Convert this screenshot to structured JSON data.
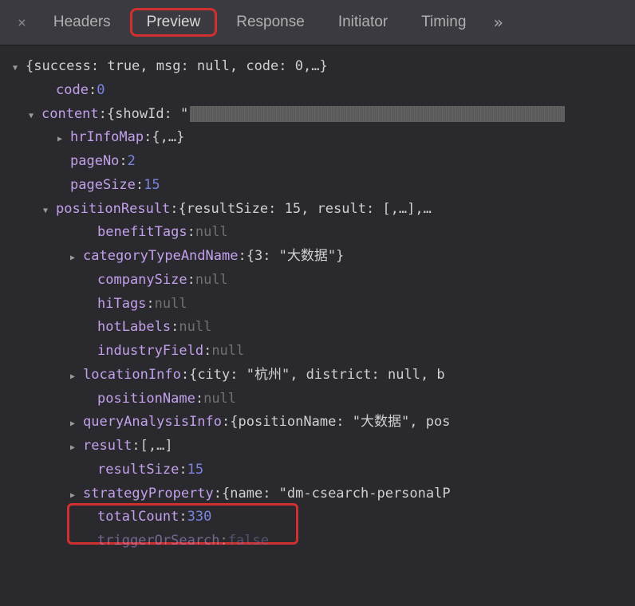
{
  "tabs": {
    "headers": "Headers",
    "preview": "Preview",
    "response": "Response",
    "initiator": "Initiator",
    "timing": "Timing",
    "overflow": "»"
  },
  "json": {
    "root_summary": "{success: true, msg: null, code: 0,…}",
    "code_key": "code",
    "code_val": "0",
    "content_key": "content",
    "content_summary": "{showId: \"",
    "hrInfoMap_key": "hrInfoMap",
    "hrInfoMap_summary": "{,…}",
    "pageNo_key": "pageNo",
    "pageNo_val": "2",
    "pageSize_key": "pageSize",
    "pageSize_val": "15",
    "positionResult_key": "positionResult",
    "positionResult_summary": "{resultSize: 15, result: [,…],…",
    "benefitTags_key": "benefitTags",
    "benefitTags_val": "null",
    "categoryTypeAndName_key": "categoryTypeAndName",
    "categoryTypeAndName_summary": "{3: \"大数据\"}",
    "companySize_key": "companySize",
    "companySize_val": "null",
    "hiTags_key": "hiTags",
    "hiTags_val": "null",
    "hotLabels_key": "hotLabels",
    "hotLabels_val": "null",
    "industryField_key": "industryField",
    "industryField_val": "null",
    "locationInfo_key": "locationInfo",
    "locationInfo_summary": "{city: \"杭州\", district: null, b",
    "positionName_key": "positionName",
    "positionName_val": "null",
    "queryAnalysisInfo_key": "queryAnalysisInfo",
    "queryAnalysisInfo_summary": "{positionName: \"大数据\", pos",
    "result_key": "result",
    "result_summary": "[,…]",
    "resultSize_key": "resultSize",
    "resultSize_val": "15",
    "strategyProperty_key": "strategyProperty",
    "strategyProperty_summary": "{name: \"dm-csearch-personalP",
    "totalCount_key": "totalCount",
    "totalCount_val": "330",
    "triggerOrSearch_key": "triggerOrSearch",
    "triggerOrSearch_val": "false"
  }
}
